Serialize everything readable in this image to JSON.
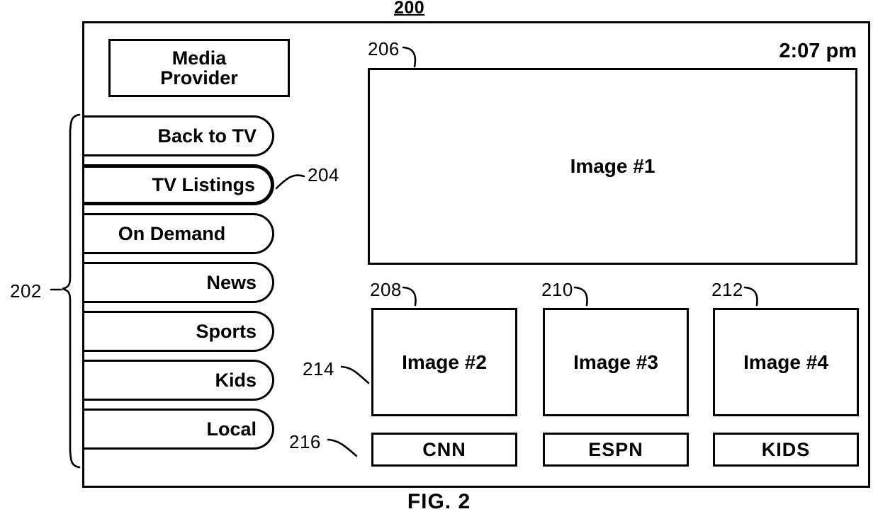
{
  "figure": {
    "top_number": "200",
    "caption": "FIG. 2"
  },
  "device": {
    "sidebar": {
      "provider": {
        "line1": "Media",
        "line2": "Provider"
      },
      "items": [
        {
          "label": "Back to TV",
          "selected": false,
          "align": "right"
        },
        {
          "label": "TV Listings",
          "selected": true,
          "align": "right"
        },
        {
          "label": "On Demand",
          "selected": false,
          "align": "center"
        },
        {
          "label": "News",
          "selected": false,
          "align": "right"
        },
        {
          "label": "Sports",
          "selected": false,
          "align": "right"
        },
        {
          "label": "Kids",
          "selected": false,
          "align": "right"
        },
        {
          "label": "Local",
          "selected": false,
          "align": "right"
        }
      ]
    },
    "main": {
      "clock": "2:07 pm",
      "hero": {
        "label": "Image #1"
      },
      "thumbnails": [
        {
          "image_label": "Image #2",
          "channel_label": "CNN"
        },
        {
          "image_label": "Image #3",
          "channel_label": "ESPN"
        },
        {
          "image_label": "Image #4",
          "channel_label": "KIDS"
        }
      ]
    }
  },
  "reference_numerals": {
    "r200": "200",
    "r202": "202",
    "r204": "204",
    "r206": "206",
    "r208": "208",
    "r210": "210",
    "r212": "212",
    "r214": "214",
    "r216": "216"
  },
  "colors": {
    "ink": "#000000",
    "paper": "#ffffff"
  }
}
